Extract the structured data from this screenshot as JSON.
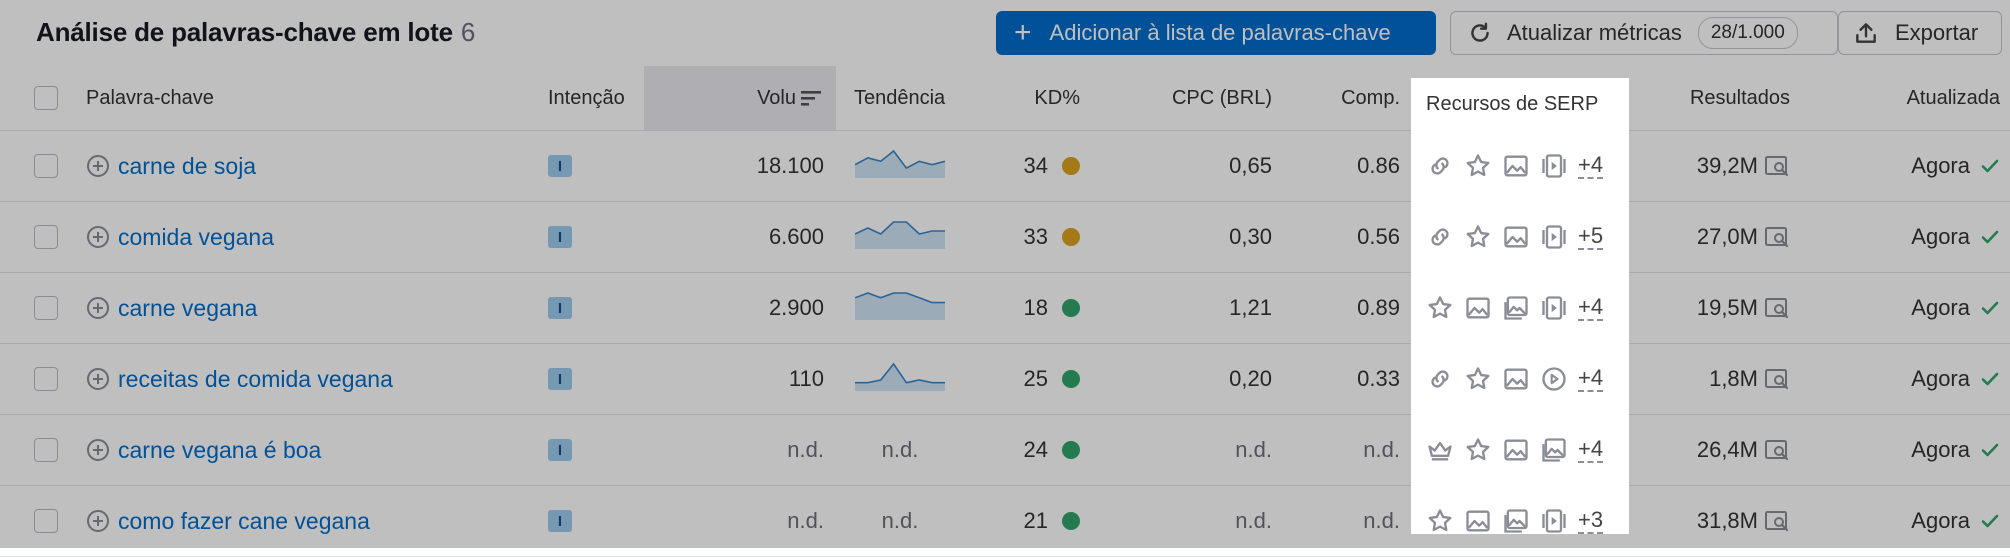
{
  "header": {
    "title": "Análise de palavras-chave em lote",
    "count": "6",
    "add_button": "Adicionar à lista de palavras-chave",
    "refresh_button": "Atualizar métricas",
    "refresh_badge": "28/1.000",
    "export_button": "Exportar"
  },
  "columns": {
    "keyword": "Palavra-chave",
    "intent": "Intenção",
    "volume": "Volu",
    "trend": "Tendência",
    "kd": "KD%",
    "cpc": "CPC (BRL)",
    "comp": "Comp.",
    "serp": "Recursos de SERP",
    "results": "Resultados",
    "updated": "Atualizada"
  },
  "colors": {
    "easy": "#31a46b",
    "possible": "#dba21f",
    "accent": "#006dca"
  },
  "rows": [
    {
      "keyword": "carne de soja",
      "intent": "I",
      "volume": "18.100",
      "trend": [
        3,
        5,
        4,
        7,
        2,
        4,
        3,
        4
      ],
      "trend_label": "",
      "kd": "34",
      "kd_color": "#dba21f",
      "cpc": "0,65",
      "comp": "0.86",
      "serp_icons": [
        "link-icon",
        "star-icon",
        "image-icon",
        "video-carousel-icon"
      ],
      "serp_more": "+4",
      "results": "39,2M",
      "updated": "Agora"
    },
    {
      "keyword": "comida vegana",
      "intent": "I",
      "volume": "6.600",
      "trend": [
        4,
        6,
        4,
        8,
        8,
        4,
        5,
        5
      ],
      "trend_label": "",
      "kd": "33",
      "kd_color": "#dba21f",
      "cpc": "0,30",
      "comp": "0.56",
      "serp_icons": [
        "link-icon",
        "star-icon",
        "image-icon",
        "video-carousel-icon"
      ],
      "serp_more": "+5",
      "results": "27,0M",
      "updated": "Agora"
    },
    {
      "keyword": "carne vegana",
      "intent": "I",
      "volume": "2.900",
      "trend": [
        4,
        5,
        4,
        5,
        5,
        4,
        3,
        3
      ],
      "trend_label": "",
      "kd": "18",
      "kd_color": "#31a46b",
      "cpc": "1,21",
      "comp": "0.89",
      "serp_icons": [
        "star-icon",
        "image-icon",
        "image-pack-icon",
        "video-carousel-icon"
      ],
      "serp_more": "+4",
      "results": "19,5M",
      "updated": "Agora"
    },
    {
      "keyword": "receitas de comida vegana",
      "intent": "I",
      "volume": "110",
      "trend": [
        2,
        2,
        3,
        9,
        2,
        3,
        2,
        2
      ],
      "trend_label": "",
      "kd": "25",
      "kd_color": "#31a46b",
      "cpc": "0,20",
      "comp": "0.33",
      "serp_icons": [
        "link-icon",
        "star-icon",
        "image-icon",
        "video-icon"
      ],
      "serp_more": "+4",
      "results": "1,8M",
      "updated": "Agora"
    },
    {
      "keyword": "carne vegana é boa",
      "intent": "I",
      "volume": "n.d.",
      "trend": [],
      "trend_label": "n.d.",
      "kd": "24",
      "kd_color": "#31a46b",
      "cpc": "n.d.",
      "comp": "n.d.",
      "serp_icons": [
        "crown-icon",
        "star-icon",
        "image-icon",
        "image-pack-icon"
      ],
      "serp_more": "+4",
      "results": "26,4M",
      "updated": "Agora"
    },
    {
      "keyword": "como fazer cane vegana",
      "intent": "I",
      "volume": "n.d.",
      "trend": [],
      "trend_label": "n.d.",
      "kd": "21",
      "kd_color": "#31a46b",
      "cpc": "n.d.",
      "comp": "n.d.",
      "serp_icons": [
        "star-icon",
        "image-icon",
        "image-pack-icon",
        "video-carousel-icon"
      ],
      "serp_more": "+3",
      "results": "31,8M",
      "updated": "Agora"
    }
  ]
}
